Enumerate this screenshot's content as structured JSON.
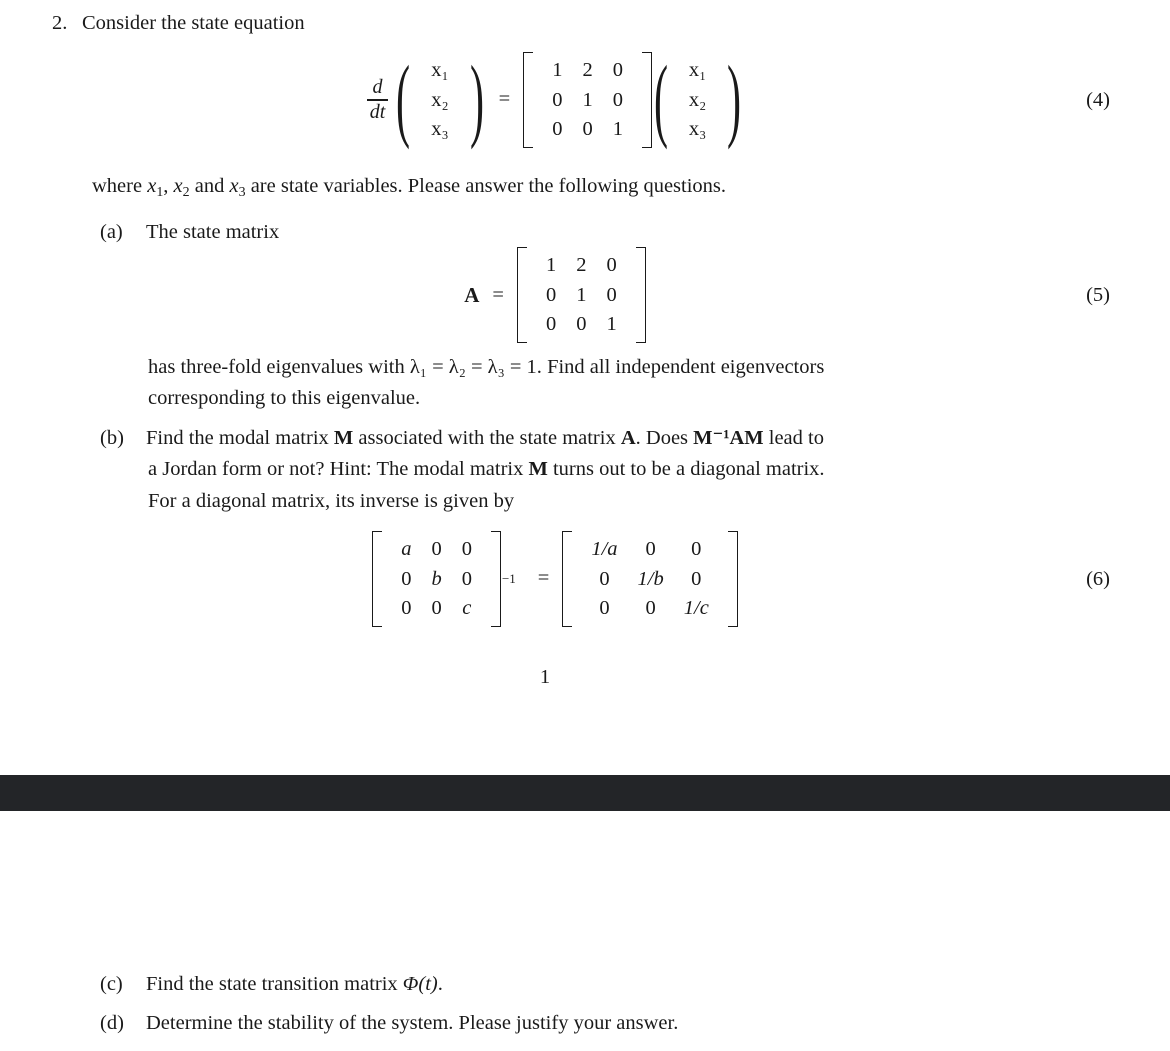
{
  "document": {
    "page_number": "1",
    "band_color": "#232528",
    "text_color": "#1a1a1a"
  },
  "problem": {
    "number": "2.",
    "stem": "Consider the state equation",
    "where_line": {
      "prefix": "where ",
      "var1": "x",
      "var1_sub": "1",
      "sep1": ", ",
      "var2": "x",
      "var2_sub": "2",
      "sep2": " and ",
      "var3": "x",
      "var3_sub": "3",
      "suffix": " are state variables.  Please answer the following questions."
    }
  },
  "equations": {
    "state_equation": {
      "number": "(4)",
      "lhs_operator_top": "d",
      "lhs_operator_bottom": "dt",
      "state_vector": [
        "x₁",
        "x₂",
        "x₃"
      ],
      "matrix": [
        [
          "1",
          "2",
          "0"
        ],
        [
          "0",
          "1",
          "0"
        ],
        [
          "0",
          "0",
          "1"
        ]
      ],
      "equals": "=",
      "rhs_vector": [
        "x₁",
        "x₂",
        "x₃"
      ]
    },
    "state_matrix": {
      "number": "(5)",
      "label": "A",
      "equals": "=",
      "matrix": [
        [
          "1",
          "2",
          "0"
        ],
        [
          "0",
          "1",
          "0"
        ],
        [
          "0",
          "0",
          "1"
        ]
      ]
    },
    "diagonal_inverse": {
      "number": "(6)",
      "lhs_matrix": [
        [
          "a",
          "0",
          "0"
        ],
        [
          "0",
          "b",
          "0"
        ],
        [
          "0",
          "0",
          "c"
        ]
      ],
      "lhs_exponent": "−1",
      "equals": "=",
      "rhs_matrix": [
        [
          "1/a",
          "0",
          "0"
        ],
        [
          "0",
          "1/b",
          "0"
        ],
        [
          "0",
          "0",
          "1/c"
        ]
      ]
    }
  },
  "parts": {
    "a": {
      "label": "(a)",
      "intro": "The state matrix",
      "after_eq_line1_pre": "has three-fold eigenvalues with ",
      "after_eq_eigen": "λ₁ = λ₂ = λ₃ = 1.",
      "after_eq_line1_post": "  Find all independent eigenvectors",
      "after_eq_line2": "corresponding to this eigenvalue."
    },
    "b": {
      "label": "(b)",
      "line1_a": "Find the modal matrix ",
      "line1_M": "M",
      "line1_b": " associated with the state matrix ",
      "line1_A": "A",
      "line1_c": ".  Does ",
      "line1_MinvAM": "M⁻¹AM",
      "line1_d": " lead to",
      "line2_a": "a Jordan form or not?  Hint: The modal matrix ",
      "line2_M": "M",
      "line2_b": " turns out to be a diagonal matrix.",
      "line3": "For a diagonal matrix, its inverse is given by"
    },
    "c": {
      "label": "(c)",
      "text_pre": "Find the state transition matrix ",
      "symbol": "Φ(t)",
      "text_post": "."
    },
    "d": {
      "label": "(d)",
      "text": "Determine the stability of the system. Please justify your answer."
    }
  }
}
